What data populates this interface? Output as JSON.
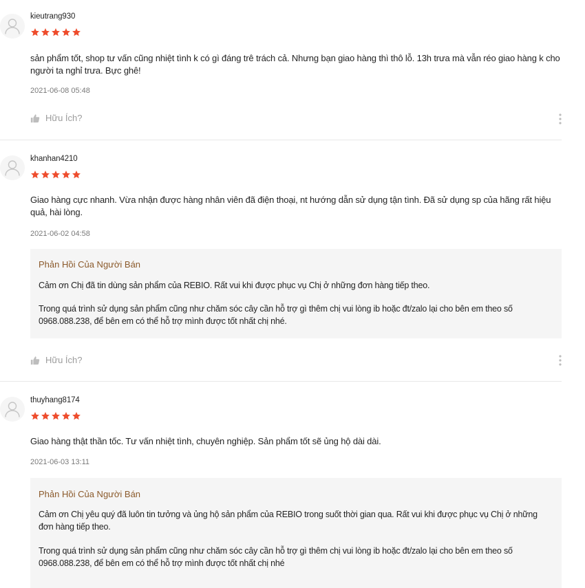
{
  "colors": {
    "star": "#ee4d2d",
    "reply_title": "#8b5a2b",
    "reply_background": "#f5f5f5",
    "muted_text": "#9e9e9e"
  },
  "reviews": [
    {
      "username": "kieutrang930",
      "rating": 5,
      "content": "sản phẩm tốt, shop tư vấn cũng nhiệt tình k có gì đáng trê trách cả. Nhưng bạn giao hàng thì thô lỗ. 13h trưa mà vẫn réo giao hàng k cho người ta nghỉ trưa. Bực ghê!",
      "date": "2021-06-08 05:48",
      "helpful_label": "Hữu Ích?",
      "icons": {
        "avatar": "user-avatar-icon",
        "helpful": "thumbs-up-icon",
        "more": "more-vertical-icon"
      }
    },
    {
      "username": "khanhan4210",
      "rating": 5,
      "content": "Giao hàng cực nhanh. Vừa nhận được hàng nhân viên đã điện thoại, nt hướng dẫn sử dụng tận tình. Đã sử dụng sp của hãng rất hiệu quả, hài lòng.",
      "date": "2021-06-02 04:58",
      "reply": {
        "title": "Phản Hồi Của Người Bán",
        "paragraphs": [
          "Cảm ơn Chị đã tin dùng sản phẩm của REBIO. Rất vui khi được phục vụ Chị ở những đơn hàng tiếp theo.",
          "Trong quá trình sử dụng sản phẩm cũng như chăm sóc cây cần hỗ trợ gì thêm chị vui lòng ib hoặc đt/zalo lại cho bên em theo số 0968.088.238, để bên em có thể hỗ trợ mình được tốt nhất chị nhé."
        ]
      },
      "helpful_label": "Hữu Ích?"
    },
    {
      "username": "thuyhang8174",
      "rating": 5,
      "content": "Giao hàng thật thần tốc. Tư vấn nhiệt tình, chuyên nghiệp. Sản phẩm tốt sẽ ủng hộ dài dài.",
      "date": "2021-06-03 13:11",
      "reply": {
        "title": "Phản Hồi Của Người Bán",
        "paragraphs": [
          "Cảm ơn Chị yêu quý đã luôn tin tưởng và ủng hộ sản phẩm của REBIO trong suốt thời gian qua. Rất vui khi được phục vụ Chị ở những đơn hàng tiếp theo.",
          "Trong quá trình sử dụng sản phẩm cũng như chăm sóc cây cần hỗ trợ gì thêm chị vui lòng ib hoặc đt/zalo lại cho bên em theo số 0968.088.238, để bên em có thể hỗ trợ mình được tốt nhất chị nhé"
        ]
      }
    }
  ]
}
